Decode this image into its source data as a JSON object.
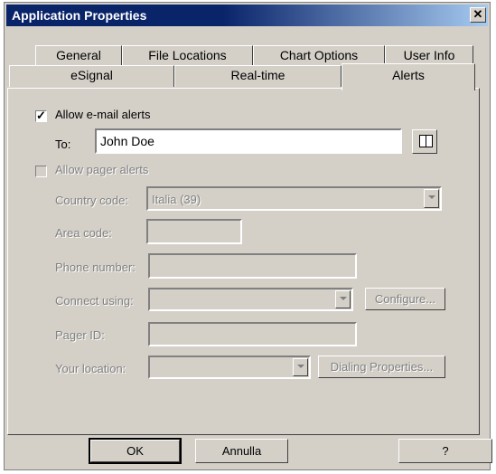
{
  "window": {
    "title": "Application Properties",
    "close_label": "✕"
  },
  "tabs": {
    "row1": [
      "General",
      "File Locations",
      "Chart Options",
      "User Info"
    ],
    "row2": [
      "eSignal",
      "Real-time",
      "Alerts"
    ],
    "active": "Alerts"
  },
  "email": {
    "checkbox_label": "Allow e-mail alerts",
    "checked": true,
    "to_label": "To:",
    "to_value": "John Doe"
  },
  "pager": {
    "checkbox_label": "Allow pager alerts",
    "checked": false,
    "country_label": "Country code:",
    "country_value": "Italia (39)",
    "area_label": "Area code:",
    "phone_label": "Phone number:",
    "connect_label": "Connect using:",
    "configure_label": "Configure...",
    "pager_id_label": "Pager ID:",
    "location_label": "Your location:",
    "dialing_label": "Dialing Properties..."
  },
  "buttons": {
    "ok": "OK",
    "cancel": "Annulla",
    "help": "?"
  }
}
